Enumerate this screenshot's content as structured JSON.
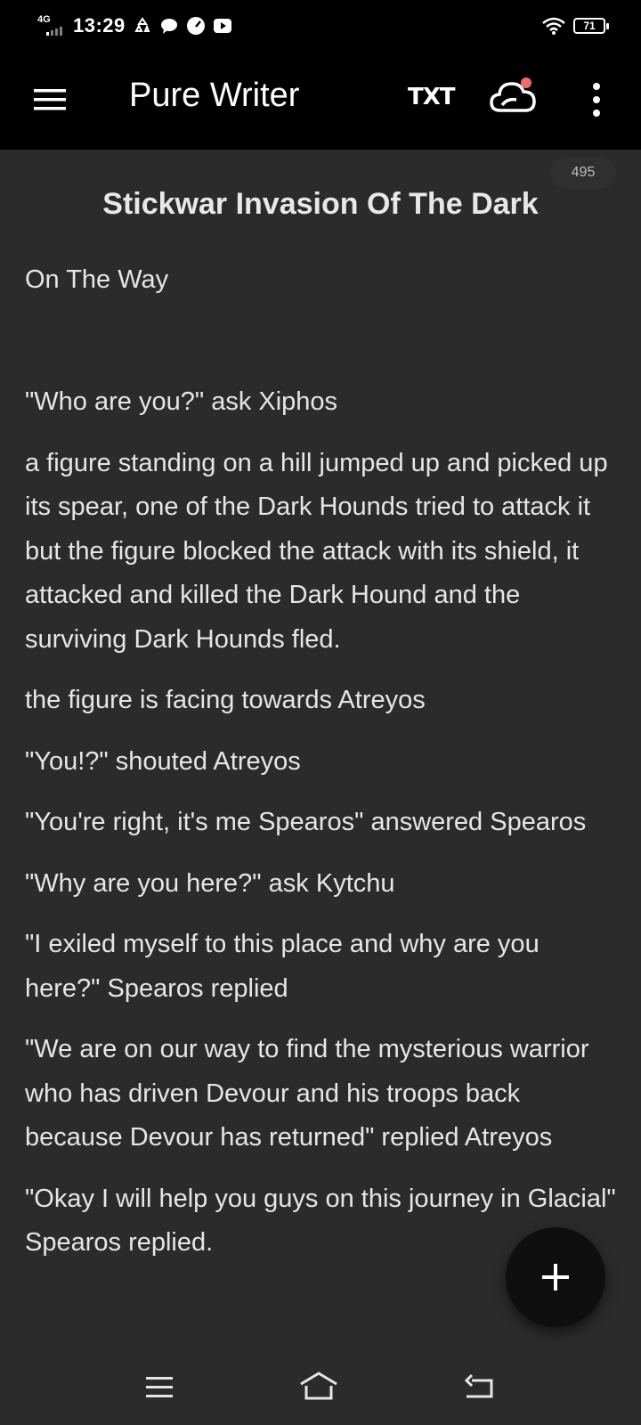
{
  "status_bar": {
    "network": "4G",
    "time": "13:29",
    "battery": "71",
    "icons": [
      "recycle-icon",
      "chat-icon",
      "speedometer-icon",
      "play-icon",
      "wifi-icon"
    ]
  },
  "toolbar": {
    "title": "Pure Writer",
    "txt_label": "TXT",
    "icons": [
      "hamburger-menu-icon",
      "cloud-sync-icon",
      "more-vertical-icon"
    ],
    "notification_dot_color": "#f26b6b"
  },
  "document": {
    "word_count": "495",
    "title": "Stickwar Invasion Of The Dark",
    "paragraphs": [
      "On The Way",
      "",
      "\"Who are you?\" ask Xiphos",
      "a figure standing on a hill jumped up and picked up its spear, one of the Dark Hounds tried to attack it but the figure blocked the attack with its shield, it attacked and killed the Dark Hound and the surviving Dark Hounds fled.",
      "the figure is facing towards Atreyos",
      "\"You!?\" shouted Atreyos",
      "\"You're right, it's me Spearos\" answered Spearos",
      "\"Why are you here?\" ask Kytchu",
      "\"I exiled myself to this place and why are you here?\" Spearos replied",
      "\"We are on our way to find the mysterious warrior who has driven Devour and his troops back because Devour has returned\" replied Atreyos",
      "\"Okay I will help you guys on this journey in Glacial\" Spearos replied."
    ]
  },
  "fab": {
    "icon": "plus-icon"
  },
  "nav_bar": {
    "icons": [
      "recent-apps-icon",
      "home-icon",
      "back-icon"
    ]
  },
  "colors": {
    "background": "#2b2b2b",
    "toolbar": "#000000",
    "text": "#e6e6e6"
  }
}
